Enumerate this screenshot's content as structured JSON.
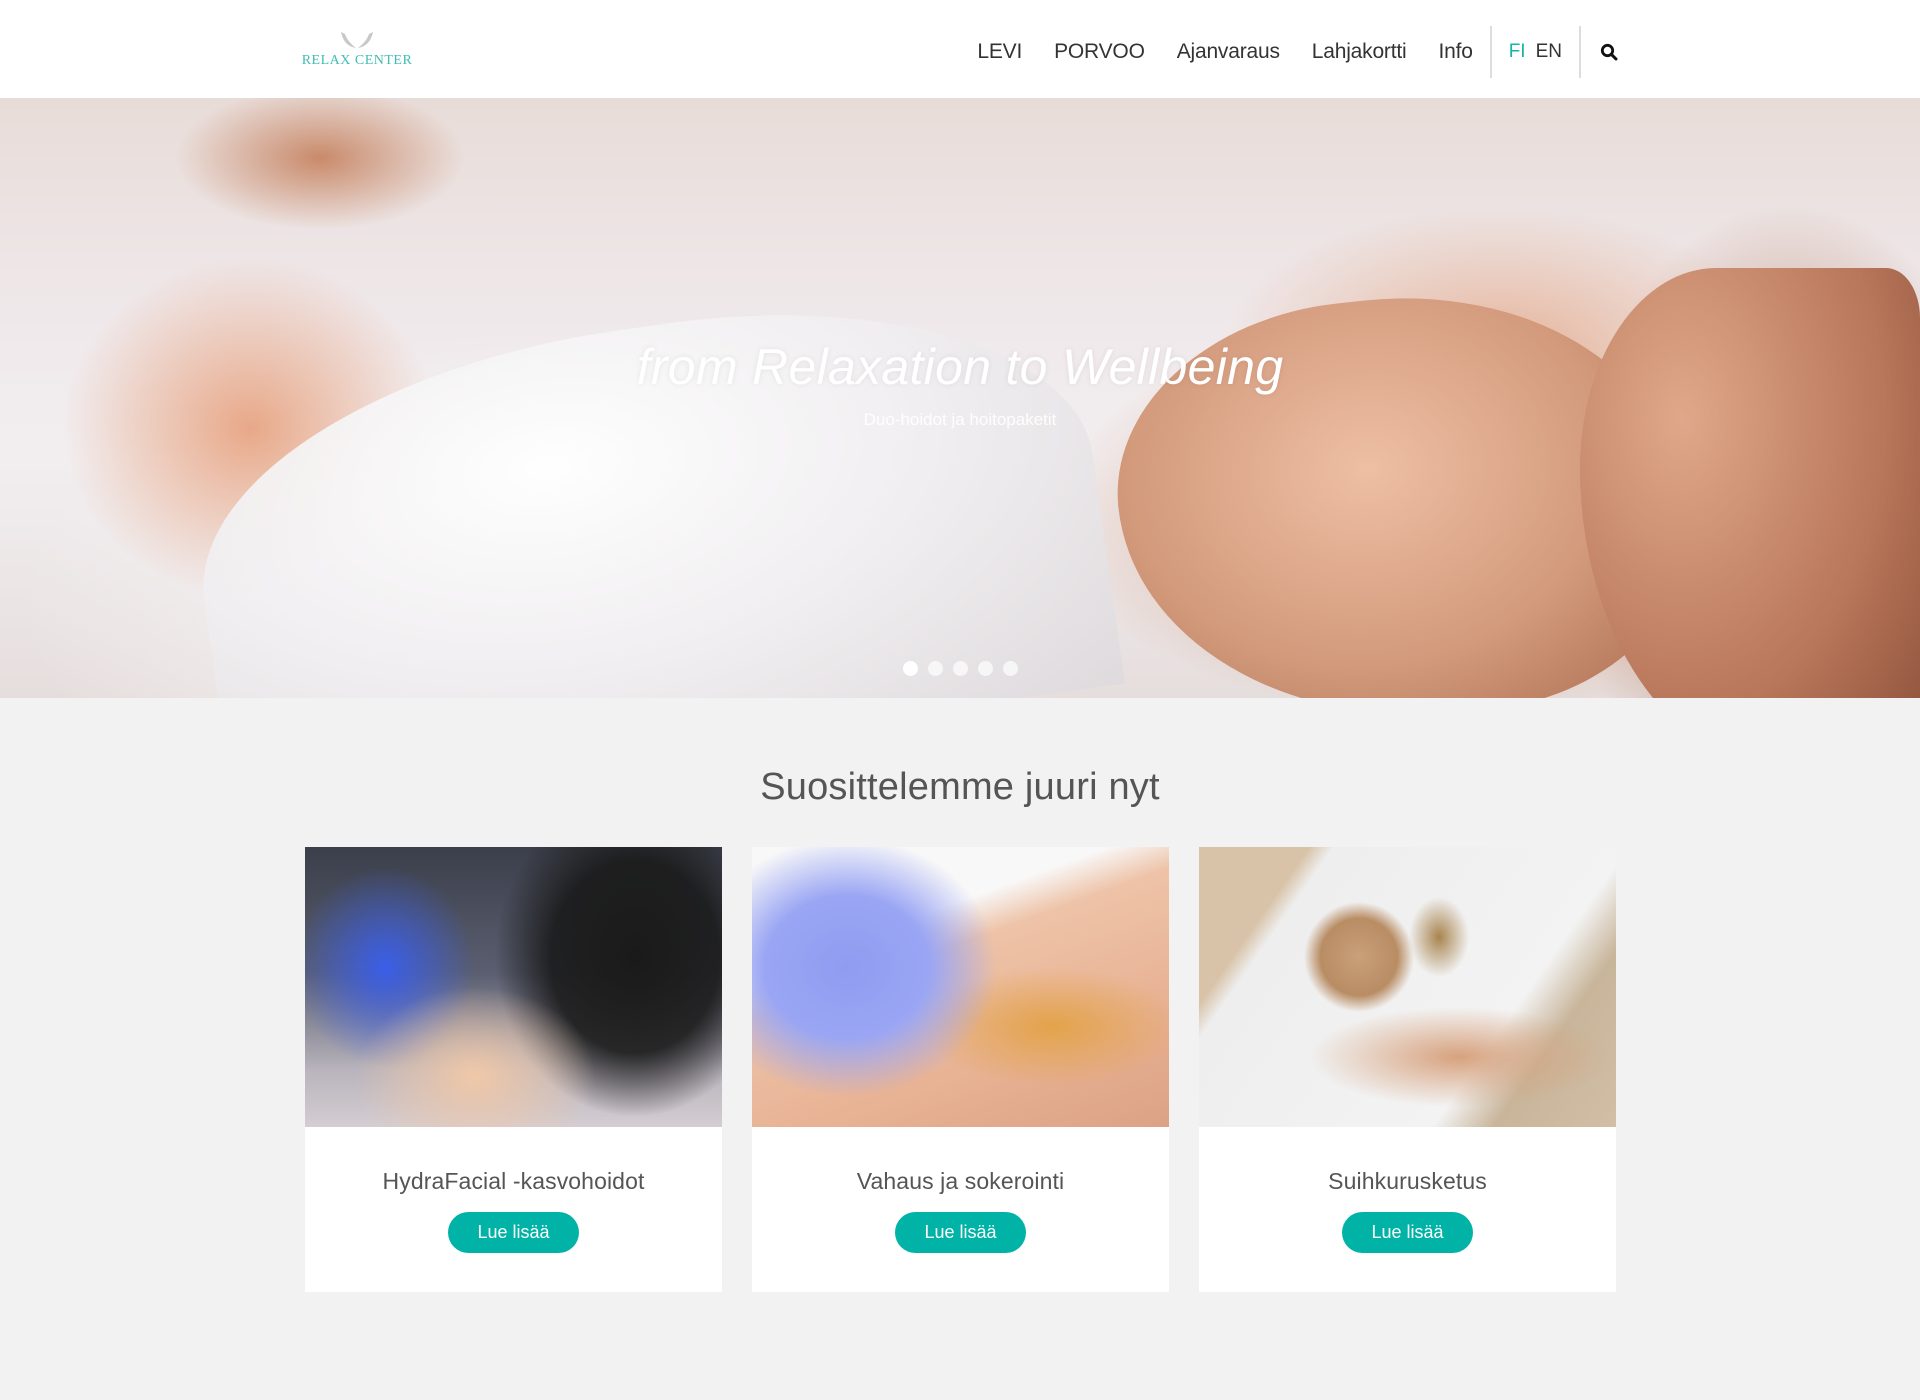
{
  "header": {
    "logo_text": "RELAX CENTER",
    "nav": [
      {
        "label": "LEVI"
      },
      {
        "label": "PORVOO"
      },
      {
        "label": "Ajanvaraus"
      },
      {
        "label": "Lahjakortti"
      },
      {
        "label": "Info"
      }
    ],
    "languages": [
      {
        "label": "FI",
        "active": true
      },
      {
        "label": "EN",
        "active": false
      }
    ],
    "search_icon": "search-icon"
  },
  "hero": {
    "title": "from Relaxation to Wellbeing",
    "subtitle": "Duo-hoidot ja hoitopaketit",
    "slide_count": 5,
    "active_slide": 1
  },
  "section": {
    "title": "Suosittelemme juuri nyt",
    "cards": [
      {
        "title": "HydraFacial -kasvohoidot",
        "button": "Lue lisää",
        "image": "facial treatment photo"
      },
      {
        "title": "Vahaus ja sokerointi",
        "button": "Lue lisää",
        "image": "waxing photo"
      },
      {
        "title": "Suihkurusketus",
        "button": "Lue lisää",
        "image": "beach towel tanning photo"
      }
    ]
  },
  "colors": {
    "accent": "#00b3a6",
    "logo": "#3fbdb4",
    "background": "#f2f2f2",
    "text": "#555555"
  }
}
